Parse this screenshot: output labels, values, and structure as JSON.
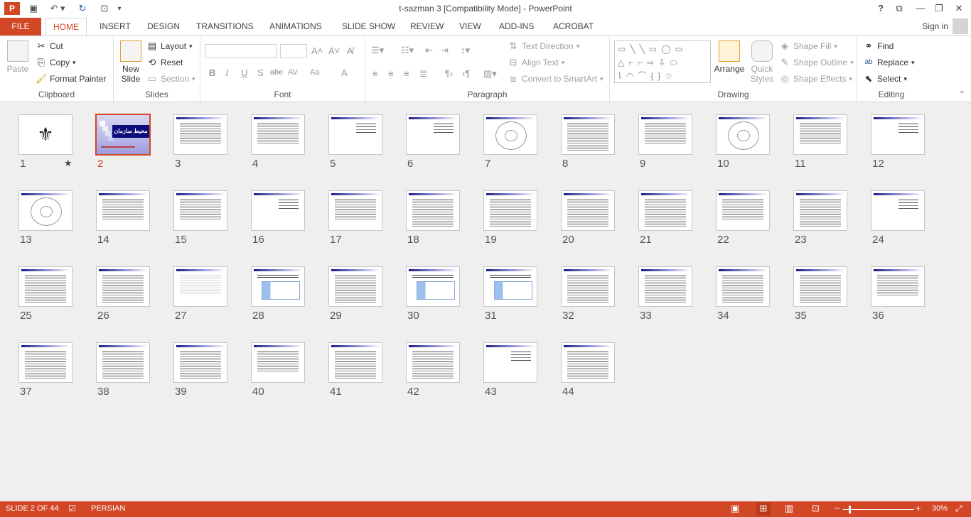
{
  "app": {
    "title": "t-sazman 3 [Compatibility Mode] - PowerPoint",
    "accent": "#d24726"
  },
  "tabs": {
    "file": "FILE",
    "items": [
      "HOME",
      "INSERT",
      "DESIGN",
      "TRANSITIONS",
      "ANIMATIONS",
      "SLIDE SHOW",
      "REVIEW",
      "VIEW",
      "ADD-INS",
      "ACROBAT"
    ],
    "active": "HOME",
    "signin": "Sign in",
    "help": "?"
  },
  "ribbon": {
    "clipboard": {
      "label": "Clipboard",
      "paste": "Paste",
      "cut": "Cut",
      "copy": "Copy",
      "format_painter": "Format Painter"
    },
    "slides": {
      "label": "Slides",
      "new_slide_1": "New",
      "new_slide_2": "Slide",
      "layout": "Layout",
      "reset": "Reset",
      "section": "Section"
    },
    "font": {
      "label": "Font",
      "buttons": [
        "B",
        "I",
        "U",
        "S",
        "abc",
        "AV",
        "Aa",
        "A"
      ]
    },
    "paragraph": {
      "label": "Paragraph",
      "text_direction": "Text Direction",
      "align_text": "Align Text",
      "smartart": "Convert to SmartArt"
    },
    "drawing": {
      "label": "Drawing",
      "arrange": "Arrange",
      "quick_styles_1": "Quick",
      "quick_styles_2": "Styles",
      "shape_fill": "Shape Fill",
      "shape_outline": "Shape Outline",
      "shape_effects": "Shape Effects"
    },
    "editing": {
      "label": "Editing",
      "find": "Find",
      "replace": "Replace",
      "select": "Select"
    }
  },
  "slides": [
    {
      "n": "1",
      "kind": "logo",
      "star": "★"
    },
    {
      "n": "2",
      "kind": "title",
      "title": "محيط سازمان",
      "selected": true
    },
    {
      "n": "3",
      "kind": "text"
    },
    {
      "n": "4",
      "kind": "text"
    },
    {
      "n": "5",
      "kind": "sparse"
    },
    {
      "n": "6",
      "kind": "sparse"
    },
    {
      "n": "7",
      "kind": "diagram"
    },
    {
      "n": "8",
      "kind": "dense"
    },
    {
      "n": "9",
      "kind": "text"
    },
    {
      "n": "10",
      "kind": "diagram"
    },
    {
      "n": "11",
      "kind": "text"
    },
    {
      "n": "12",
      "kind": "sparse"
    },
    {
      "n": "13",
      "kind": "diagram"
    },
    {
      "n": "14",
      "kind": "text"
    },
    {
      "n": "15",
      "kind": "text"
    },
    {
      "n": "16",
      "kind": "sparse"
    },
    {
      "n": "17",
      "kind": "text"
    },
    {
      "n": "18",
      "kind": "dense"
    },
    {
      "n": "19",
      "kind": "dense"
    },
    {
      "n": "20",
      "kind": "dense"
    },
    {
      "n": "21",
      "kind": "dense"
    },
    {
      "n": "22",
      "kind": "text"
    },
    {
      "n": "23",
      "kind": "dense"
    },
    {
      "n": "24",
      "kind": "sparse"
    },
    {
      "n": "25",
      "kind": "dense"
    },
    {
      "n": "26",
      "kind": "dense"
    },
    {
      "n": "27",
      "kind": "light"
    },
    {
      "n": "28",
      "kind": "table"
    },
    {
      "n": "29",
      "kind": "dense"
    },
    {
      "n": "30",
      "kind": "table"
    },
    {
      "n": "31",
      "kind": "table"
    },
    {
      "n": "32",
      "kind": "dense"
    },
    {
      "n": "33",
      "kind": "dense"
    },
    {
      "n": "34",
      "kind": "dense"
    },
    {
      "n": "35",
      "kind": "dense"
    },
    {
      "n": "36",
      "kind": "text"
    },
    {
      "n": "37",
      "kind": "dense"
    },
    {
      "n": "38",
      "kind": "dense"
    },
    {
      "n": "39",
      "kind": "dense"
    },
    {
      "n": "40",
      "kind": "text"
    },
    {
      "n": "41",
      "kind": "dense"
    },
    {
      "n": "42",
      "kind": "dense"
    },
    {
      "n": "43",
      "kind": "sparse"
    },
    {
      "n": "44",
      "kind": "dense"
    }
  ],
  "status": {
    "slide_info": "SLIDE 2 OF 44",
    "language": "PERSIAN",
    "zoom": "30%"
  }
}
